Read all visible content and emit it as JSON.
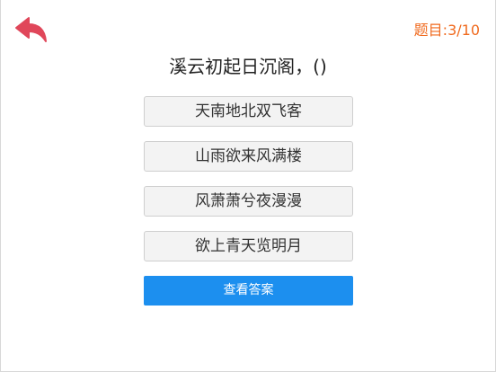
{
  "header": {
    "back_icon": "back-arrow-icon",
    "progress_label": "题目:3/10"
  },
  "quiz": {
    "question": "溪云初起日沉阁，()",
    "options": [
      "天南地北双飞客",
      "山雨欲来风满楼",
      "风萧萧兮夜漫漫",
      "欲上青天览明月"
    ],
    "show_answer_label": "查看答案"
  },
  "colors": {
    "accent_back": "#e0475a",
    "progress_text": "#f06a1e",
    "primary_button": "#1c8fef",
    "option_bg": "#f3f3f3"
  }
}
